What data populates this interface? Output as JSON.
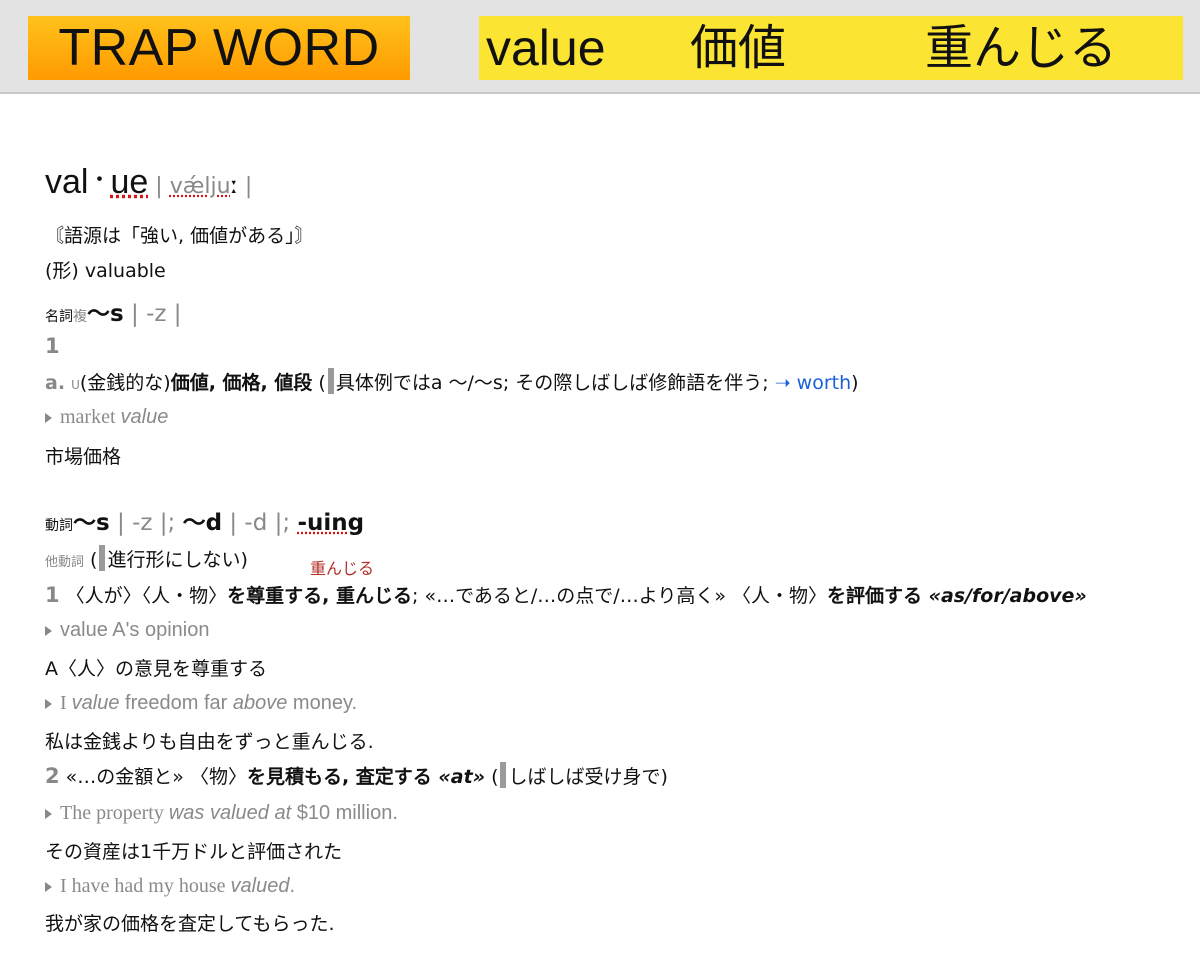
{
  "banner": {
    "trap_label": "TRAP WORD",
    "word": "value",
    "meaning1": "価値",
    "meaning2": "重んじる"
  },
  "entry": {
    "head_a": "val",
    "head_dot": "・",
    "head_b": "ue",
    "pron_bar1": " | ",
    "pron": "vǽlju",
    "pron_colon": "ː",
    "pron_bar2": " |",
    "etymology": "〘語源は「強い, 価値がある」〙",
    "adj": "(形) valuable",
    "noun_pos": "名詞",
    "noun_pl_tag": "複",
    "noun_pl": "〜s",
    "noun_pl_pron": " | -z |",
    "sense1_num": "1",
    "sense1a_label": "a.",
    "sense1a_u": "U",
    "sense1a_paren": "(金銭的な)",
    "sense1a_defs": "価値, 価格, 値段",
    "sense1a_note_open": " (",
    "sense1a_note": "具体例ではa 〜/〜s; その際しばしば修飾語を伴う; ",
    "sense1a_arrow": "➝ worth",
    "sense1a_close": ")",
    "ex1_a": "market ",
    "ex1_b": "value",
    "ex1_tr": "市場価格",
    "verb_pos": "動詞",
    "verb_s": "〜s",
    "verb_s_pron": " | -z |; ",
    "verb_d": "〜d",
    "verb_d_pron": " | -d |; ",
    "verb_ing": "-uing",
    "vt_tag": "他動詞",
    "vt_note_open": " (",
    "vt_note": "進行形にしない)",
    "annotation": "重んじる",
    "v1_num": "1",
    "v1_obj": " 〈人が〉〈人・物〉",
    "v1_defs": "を尊重する, 重んじる",
    "v1_mid": "; «…であると/…の点で/…より高く» 〈人・物〉",
    "v1_def2": "を評価する",
    "v1_preps": " «as/for/above»",
    "ex2": "value A's opinion",
    "ex2_tr": "A〈人〉の意見を尊重する",
    "ex3_a": "I ",
    "ex3_b": "value",
    "ex3_c": " freedom far ",
    "ex3_d": "above",
    "ex3_e": " money.",
    "ex3_tr": "私は金銭よりも自由をずっと重んじる.",
    "v2_num": "2",
    "v2_obj": " «…の金額と» 〈物〉",
    "v2_defs": "を見積もる, 査定する",
    "v2_prep": " «at»",
    "v2_note_open": " (",
    "v2_note": "しばしば受け身で)",
    "ex4_a": "The property ",
    "ex4_b": "was valued at",
    "ex4_c": " $10 million.",
    "ex4_tr": "その資産は1千万ドルと評価された",
    "ex5_a": "I have had my house ",
    "ex5_b": "valued",
    "ex5_c": ".",
    "ex5_tr": "我が家の価格を査定してもらった."
  }
}
